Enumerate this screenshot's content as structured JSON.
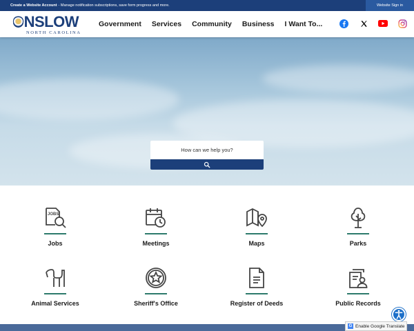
{
  "topbar": {
    "account_link": "Create a Website Account",
    "account_text": " - Manage notification subscriptions, save form progress and more.",
    "signin": "Website Sign in"
  },
  "logo": {
    "title": "ONSLOW",
    "subtitle": "NORTH CAROLINA"
  },
  "nav": [
    "Government",
    "Services",
    "Community",
    "Business",
    "I Want To..."
  ],
  "social": [
    {
      "name": "facebook-icon",
      "color": "#1877f2"
    },
    {
      "name": "x-icon",
      "color": "#000000"
    },
    {
      "name": "youtube-icon",
      "color": "#ff0000"
    },
    {
      "name": "instagram-icon",
      "color": "#d6249f"
    }
  ],
  "search": {
    "placeholder": "How can we help you?"
  },
  "tiles": [
    {
      "label": "Jobs",
      "icon": "jobs-icon"
    },
    {
      "label": "Meetings",
      "icon": "calendar-clock-icon"
    },
    {
      "label": "Maps",
      "icon": "map-pin-icon"
    },
    {
      "label": "Parks",
      "icon": "tree-icon"
    },
    {
      "label": "Animal Services",
      "icon": "dog-icon"
    },
    {
      "label": "Sheriff's Office",
      "icon": "sheriff-badge-icon"
    },
    {
      "label": "Register of Deeds",
      "icon": "document-icon"
    },
    {
      "label": "Public Records",
      "icon": "records-person-icon"
    }
  ],
  "translate": "Enable Google Translate",
  "colors": {
    "brand": "#1c3f7a",
    "accent": "#2c7a6b"
  }
}
